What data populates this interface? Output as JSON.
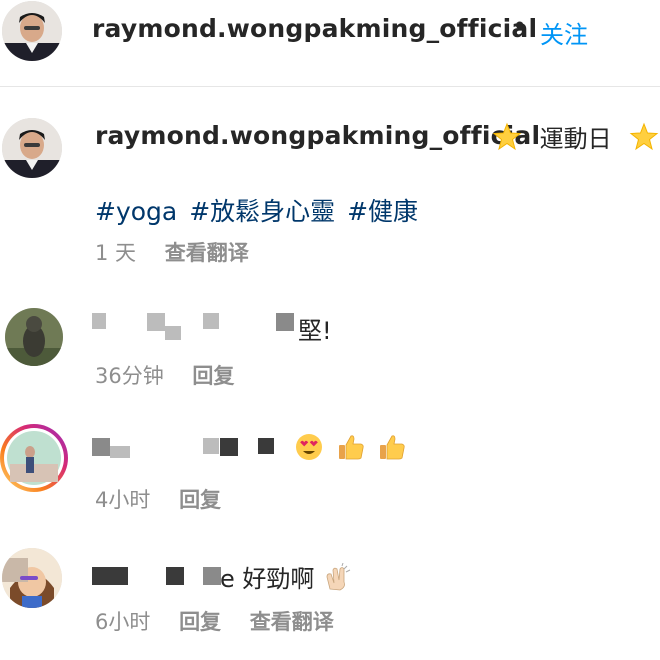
{
  "header": {
    "username": "raymond.wongpakming_official",
    "separator": "•",
    "follow_label": "关注"
  },
  "caption": {
    "username": "raymond.wongpakming_official",
    "text": "運動日",
    "hashtags": [
      "#yoga",
      "#放鬆身心靈",
      "#健康"
    ],
    "time": "1 天",
    "translate_label": "查看翻译"
  },
  "comments": [
    {
      "text": "堅!",
      "time": "36分钟",
      "reply_label": "回复"
    },
    {
      "text": "",
      "time": "4小时",
      "reply_label": "回复"
    },
    {
      "text": "e 好勁啊",
      "time": "6小时",
      "reply_label": "回复",
      "translate_label": "查看翻译"
    }
  ],
  "colors": {
    "link_blue": "#0095f6",
    "hashtag_blue": "#00376b",
    "meta_gray": "#8e8e8e",
    "text": "#262626"
  },
  "icons": {
    "star": "glowing-star-icon",
    "heart_eyes": "heart-eyes-emoji-icon",
    "thumbs_up": "thumbs-up-emoji-icon",
    "clap": "clapping-hands-emoji-icon"
  }
}
